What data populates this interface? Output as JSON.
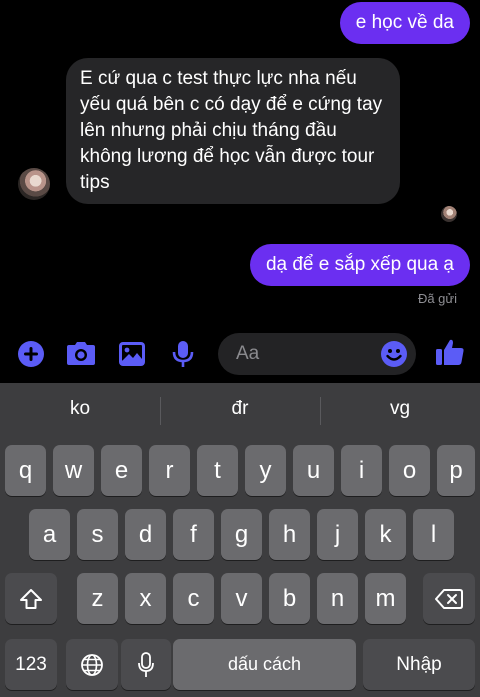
{
  "chat": {
    "messages": [
      {
        "direction": "out",
        "text": "e học về da"
      },
      {
        "direction": "in",
        "text": "E cứ qua c test thực lực nha nếu yếu quá bên c có dạy để e cứng tay lên nhưng phải chịu tháng đầu không lương để học vẫn được tour tips"
      },
      {
        "direction": "out",
        "text": "dạ để e sắp xếp qua ạ"
      }
    ],
    "status": "Đã gửi"
  },
  "composer": {
    "placeholder": "Aa",
    "icons": [
      "plus-icon",
      "camera-icon",
      "gallery-icon",
      "microphone-icon",
      "emoji-icon",
      "like-icon"
    ]
  },
  "keyboard": {
    "suggestions": [
      "ko",
      "đr",
      "vg"
    ],
    "row1": [
      "q",
      "w",
      "e",
      "r",
      "t",
      "y",
      "u",
      "i",
      "o",
      "p"
    ],
    "row2": [
      "a",
      "s",
      "d",
      "f",
      "g",
      "h",
      "j",
      "k",
      "l"
    ],
    "row3": [
      "z",
      "x",
      "c",
      "v",
      "b",
      "n",
      "m"
    ],
    "numbers_label": "123",
    "space_label": "dấu cách",
    "return_label": "Nhập"
  },
  "colors": {
    "accent": "#6b2ff1",
    "icon_accent": "#5b5cf6",
    "incoming_bubble": "#262628",
    "keyboard_bg": "#3d3d3f",
    "key": "#6b6b6e",
    "function_key": "#4b4b4e"
  }
}
